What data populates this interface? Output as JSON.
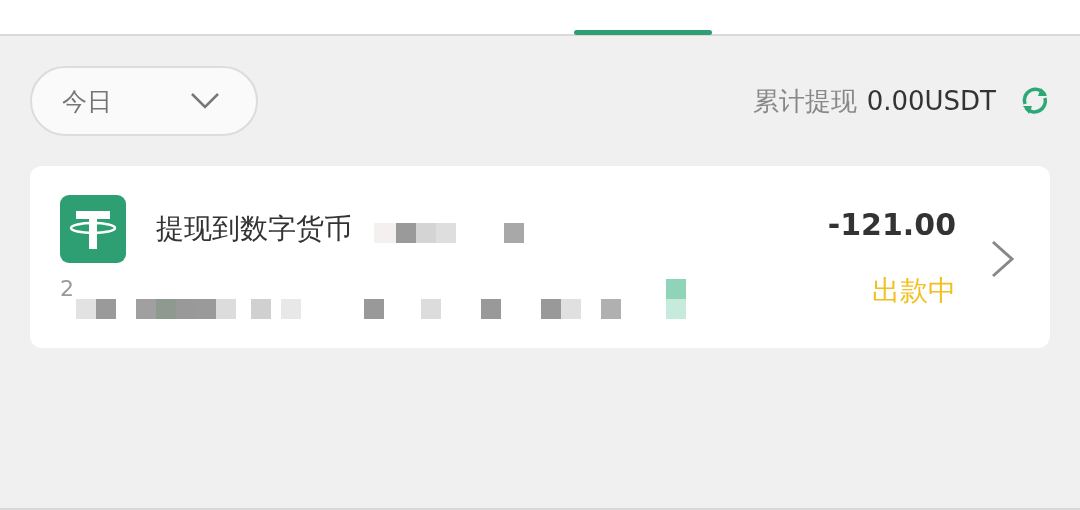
{
  "filter": {
    "value": "今日"
  },
  "summary": {
    "label": "累计提现",
    "amount": "0.00USDT"
  },
  "records": [
    {
      "title": "提现到数字货币",
      "date": "2",
      "amount": "-121.00",
      "status": "出款中"
    }
  ]
}
